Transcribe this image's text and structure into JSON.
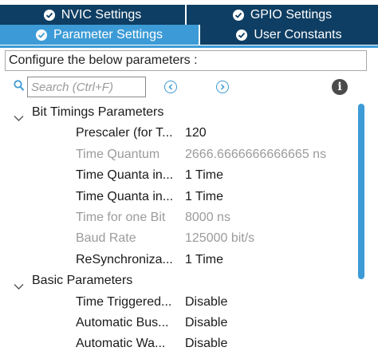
{
  "tabs": [
    {
      "label": "NVIC Settings",
      "state": "inactive"
    },
    {
      "label": "GPIO Settings",
      "state": "inactive"
    },
    {
      "label": "Parameter Settings",
      "state": "active"
    },
    {
      "label": "User Constants",
      "state": "inactive"
    }
  ],
  "header": {
    "text": "Configure the below parameters :"
  },
  "search": {
    "placeholder": "Search (Ctrl+F)",
    "value": ""
  },
  "toolbar": {
    "prev_icon": "circle-chevron-left",
    "next_icon": "circle-chevron-right",
    "info_icon": "info-circle"
  },
  "tree": {
    "groups": [
      {
        "label": "Bit Timings Parameters",
        "expanded": true,
        "params": [
          {
            "name": "Prescaler (for T...",
            "value": "120",
            "enabled": true
          },
          {
            "name": "Time Quantum",
            "value": "2666.6666666666665 ns",
            "enabled": false
          },
          {
            "name": "Time Quanta in...",
            "value": "1 Time",
            "enabled": true
          },
          {
            "name": "Time Quanta in...",
            "value": "1 Time",
            "enabled": true
          },
          {
            "name": "Time for one Bit",
            "value": "8000 ns",
            "enabled": false
          },
          {
            "name": "Baud Rate",
            "value": "125000 bit/s",
            "enabled": false
          },
          {
            "name": "ReSynchroniza...",
            "value": "1 Time",
            "enabled": true
          }
        ]
      },
      {
        "label": "Basic Parameters",
        "expanded": true,
        "params": [
          {
            "name": "Time Triggered...",
            "value": "Disable",
            "enabled": true
          },
          {
            "name": "Automatic Bus...",
            "value": "Disable",
            "enabled": true
          },
          {
            "name": "Automatic Wa...",
            "value": "Disable",
            "enabled": true
          }
        ]
      }
    ]
  },
  "colors": {
    "tab_dark": "#0e3e63",
    "tab_active": "#3c9bd6",
    "scroll_thumb": "#3c9bd6",
    "disabled_text": "#9b9b9b"
  }
}
